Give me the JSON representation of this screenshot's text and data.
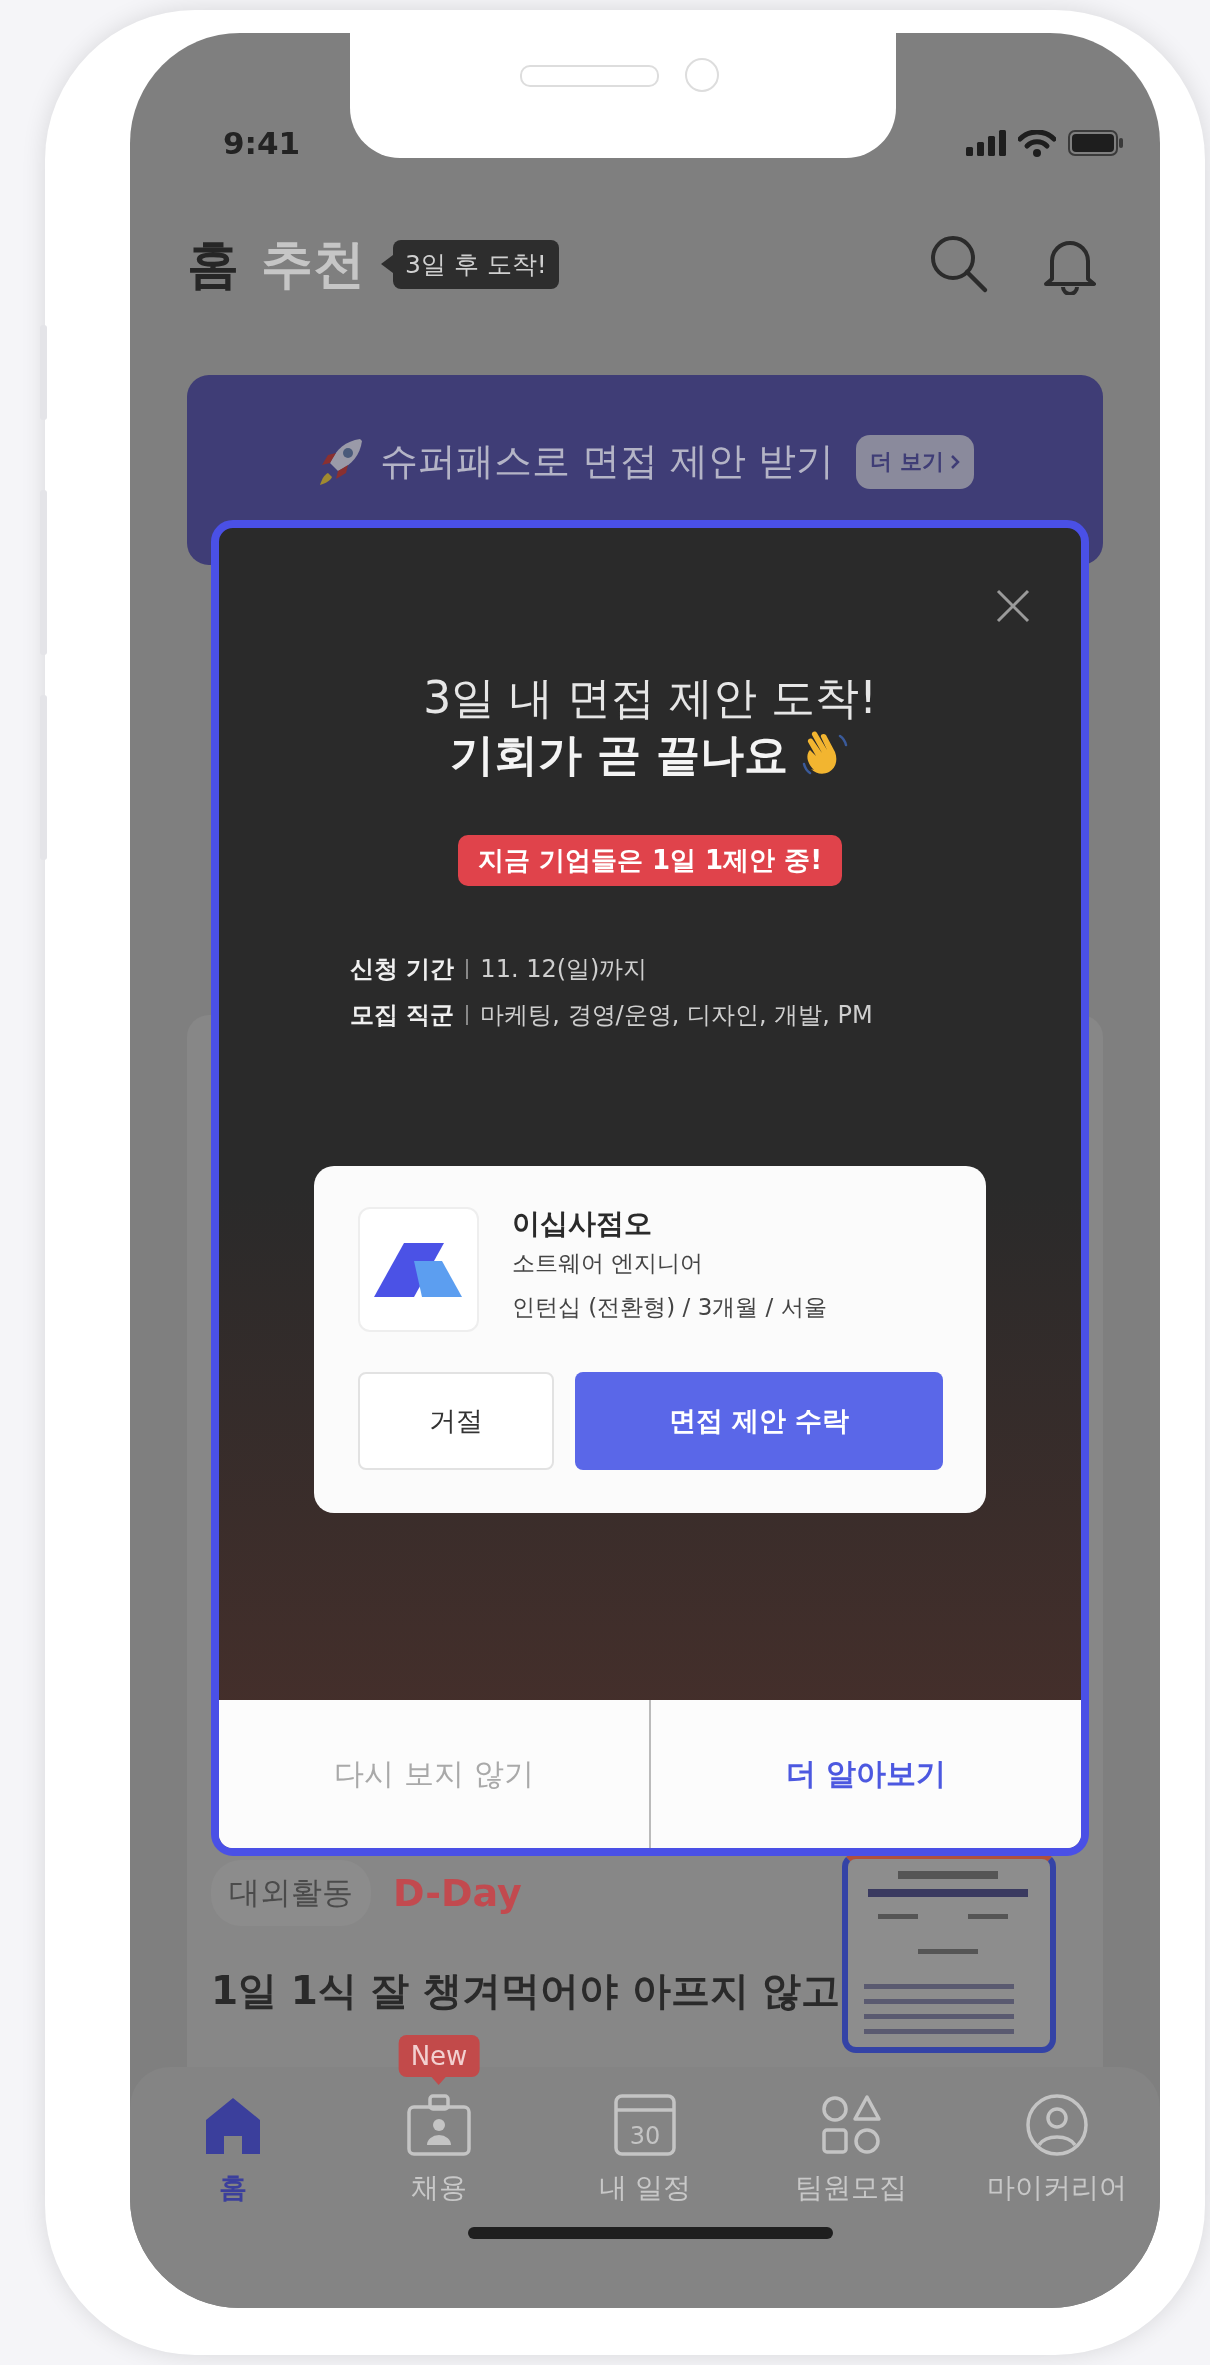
{
  "status_bar": {
    "time": "9:41"
  },
  "header": {
    "tabs": [
      {
        "label": "홈",
        "selected": true
      },
      {
        "label": "추천",
        "selected": false
      }
    ],
    "tooltip": "3일 후 도착!"
  },
  "banner": {
    "text": "슈퍼패스로 면접 제안 받기",
    "button": "더 보기"
  },
  "feed_item": {
    "tag": "대외활동",
    "deadline": "D-Day",
    "title": "1일 1식 잘 챙겨먹어야 아프지 않고"
  },
  "modal": {
    "title": "3일 내 면접 제안 도착!",
    "subtitle": "기회가 곧 끝나요",
    "badge": "지금 기업들은 1일 1제안 중!",
    "details": [
      {
        "label": "신청 기간",
        "value": "11. 12(일)까지"
      },
      {
        "label": "모집 직군",
        "value": "마케팅, 경영/운영, 디자인, 개발, PM"
      }
    ],
    "offer": {
      "company": "이십사점오",
      "role": "소트웨어 엔지니어",
      "terms": "인턴십 (전환형) / 3개월 / 서울",
      "decline": "거절",
      "accept": "면접 제안 수락"
    },
    "footer": {
      "dismiss": "다시 보지 않기",
      "learn_more": "더 알아보기"
    }
  },
  "tab_bar": {
    "items": [
      {
        "label": "홈",
        "selected": true
      },
      {
        "label": "채용",
        "selected": false,
        "badge": "New"
      },
      {
        "label": "내 일정",
        "selected": false,
        "icon_label": "30"
      },
      {
        "label": "팀원모집",
        "selected": false
      },
      {
        "label": "마이커리어",
        "selected": false
      }
    ]
  }
}
